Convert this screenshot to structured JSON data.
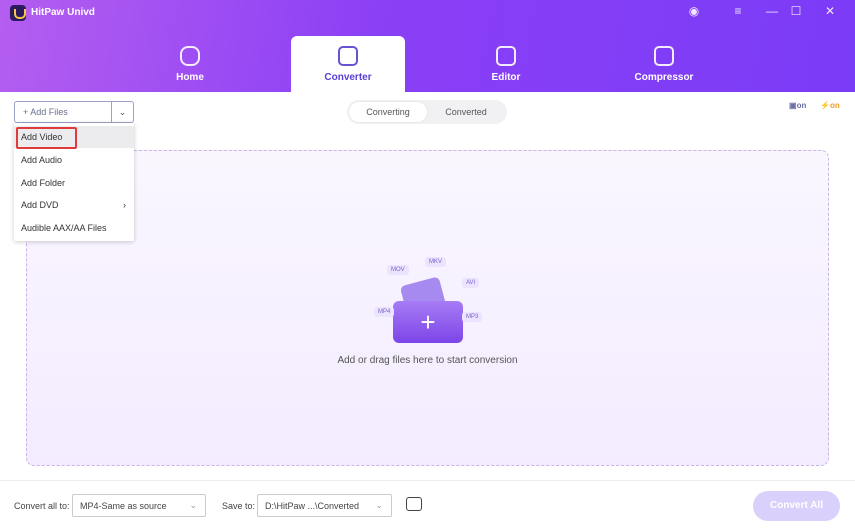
{
  "app": {
    "title": "HitPaw Univd"
  },
  "window_controls": [
    {
      "icon": "account-icon",
      "glyph": "◉"
    },
    {
      "icon": "menu-icon",
      "glyph": "≡"
    },
    {
      "icon": "minimize-icon",
      "glyph": "—"
    },
    {
      "icon": "maximize-icon",
      "glyph": "☐"
    },
    {
      "icon": "close-icon",
      "glyph": "✕"
    }
  ],
  "tabs": [
    {
      "label": "Home",
      "active": false
    },
    {
      "label": "Converter",
      "active": true
    },
    {
      "label": "Editor",
      "active": false
    },
    {
      "label": "Compressor",
      "active": false
    }
  ],
  "toolbar": {
    "add_files": "+ Add Files",
    "segments": [
      "Converting",
      "Converted"
    ],
    "hw_accel": "on",
    "lightning": "on"
  },
  "menu": {
    "items": [
      "Add Video",
      "Add Audio",
      "Add Folder",
      "Add DVD",
      "Audible AAX/AA Files"
    ],
    "highlighted": "Add Video",
    "submenu_arrow": "›"
  },
  "dropzone": {
    "text": "Add or drag files here to start conversion",
    "formats": [
      "MOV",
      "MKV",
      "AVI",
      "MP4",
      "MP3"
    ]
  },
  "bottom": {
    "convert_all_to_label": "Convert all to:",
    "format_value": "MP4-Same as source",
    "save_to_label": "Save to:",
    "save_path": "D:\\HitPaw ...\\Converted",
    "convert_all": "Convert All"
  },
  "colors": {
    "accent": "#7b3cf7",
    "convert_disabled": "#d9d1fc",
    "highlight_border": "#e03b3b",
    "lightning": "#f29a1f"
  }
}
